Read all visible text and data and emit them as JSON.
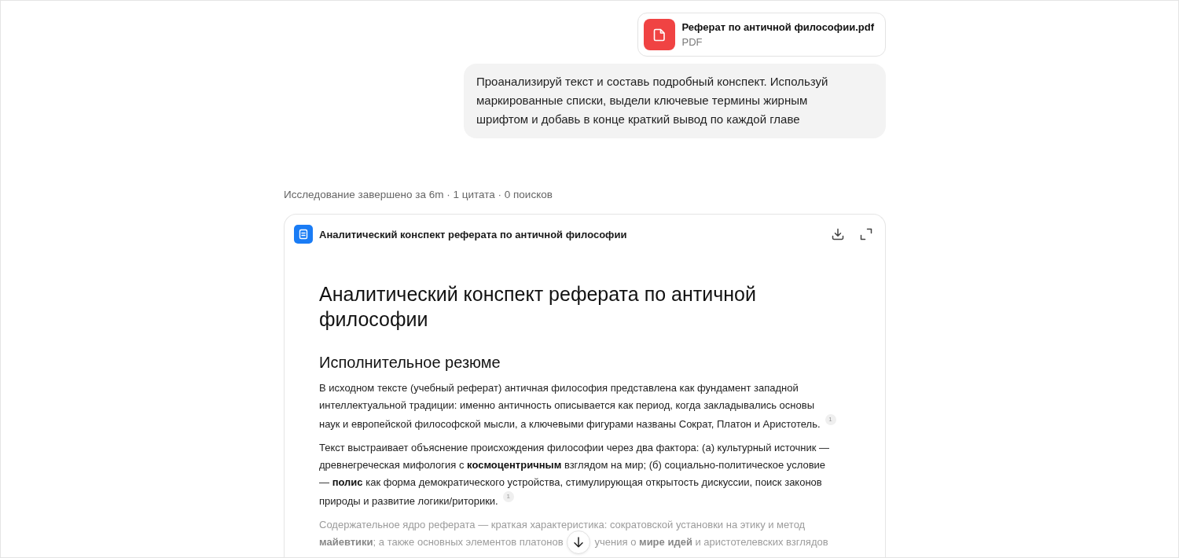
{
  "attachment": {
    "name": "Реферат по античной философии.pdf",
    "type": "PDF"
  },
  "user_message": {
    "text": "Проанализируй текст и составь подробный конспект. Используй маркированные списки, выдели ключевые термины жирным шрифтом и добавь в конце краткий вывод по каждой главе"
  },
  "research_status": "Исследование завершено за 6m · 1 цитата · 0 поисков",
  "document": {
    "title": "Аналитический конспект реферата по античной философии",
    "heading": "Аналитический конспект реферата по античной философии",
    "sections": [
      {
        "heading": "Исполнительное резюме",
        "paragraphs": [
          {
            "text": "В исходном тексте (учебный реферат) античная философия представлена как фундамент западной интеллектуальной традиции: именно античность описывается как период, когда закладывались основы наук и европейской философской мысли, а ключевыми фигурами названы Сократ, Платон и Аристотель.",
            "citation": "1",
            "faded": false
          },
          {
            "text": "Текст выстраивает объяснение происхождения философии через два фактора: (а) культурный источник — древнегреческая мифология с **космоцентричным** взглядом на мир; (б) социально-политическое условие — **полис** как форма демократического устройства, стимулирующая открытость дискуссии, поиск законов природы и развитие логики/риторики.",
            "citation": "1",
            "faded": false
          },
          {
            "text": "Содержательное ядро реферата — краткая характеристика: сократовской установки на этику и метод **майевтики**; а также основных элементов платонов",
            "text_after_button": "учения о **мире идей** и аристотелевских взглядов",
            "faded": true
          }
        ]
      }
    ]
  }
}
